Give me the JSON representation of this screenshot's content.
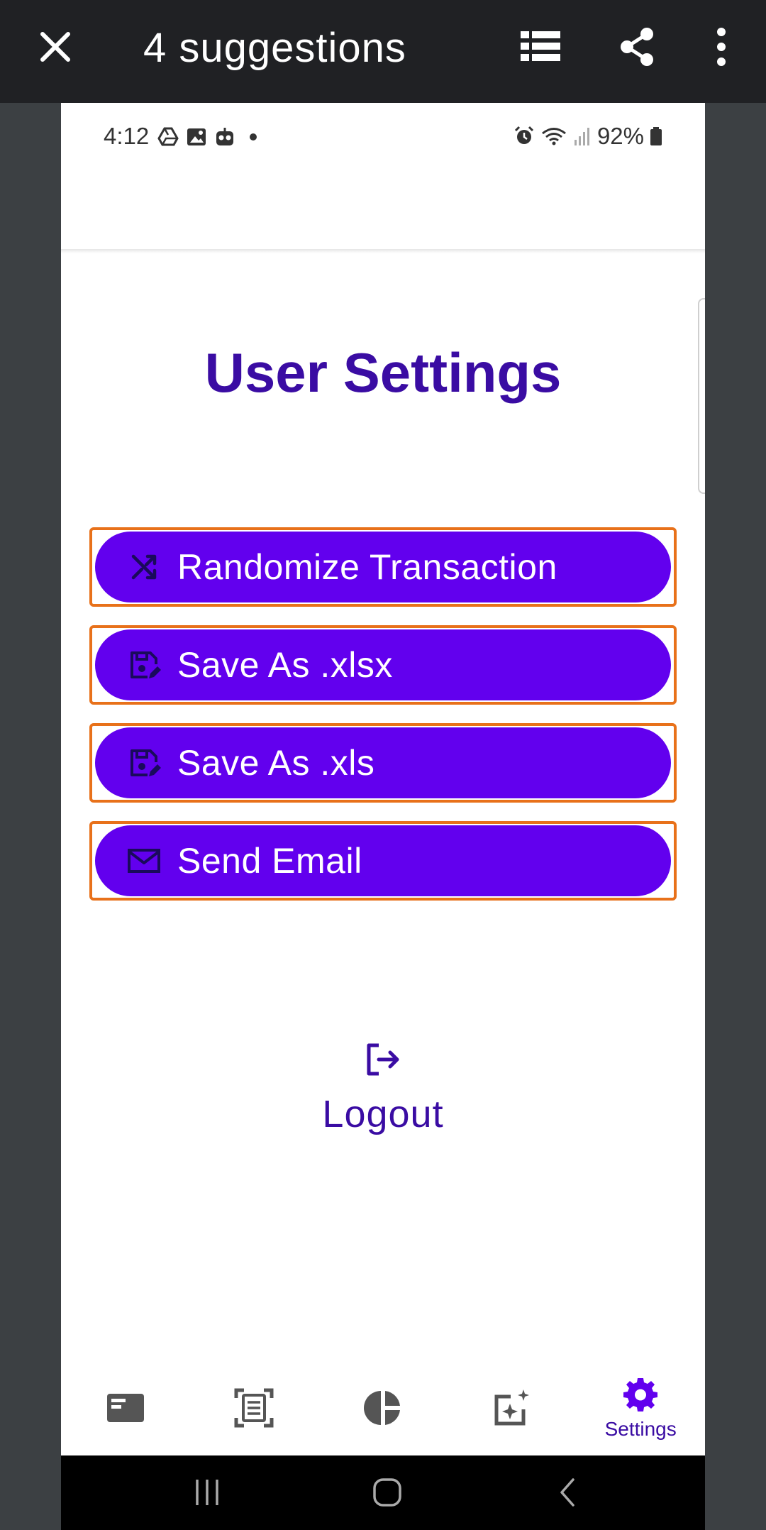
{
  "viewer": {
    "title": "4 suggestions",
    "icons": {
      "close": "close-icon",
      "list": "list-view-icon",
      "share": "share-icon",
      "more": "more-vert-icon"
    }
  },
  "status_bar": {
    "time": "4:12",
    "battery": "92%",
    "icons": [
      "drive-icon",
      "gallery-icon",
      "robot-icon",
      "dot",
      "alarm-icon",
      "wifi-icon",
      "signal-icon",
      "battery-icon"
    ]
  },
  "page": {
    "title": "User Settings"
  },
  "actions": [
    {
      "label": "Randomize Transaction",
      "icon": "shuffle-icon"
    },
    {
      "label": "Save As .xlsx",
      "icon": "save-edit-icon"
    },
    {
      "label": "Save As .xls",
      "icon": "save-edit-icon"
    },
    {
      "label": "Send Email",
      "icon": "mail-icon"
    }
  ],
  "logout": {
    "label": "Logout",
    "icon": "logout-icon"
  },
  "bottom_nav": {
    "items": [
      {
        "icon": "card-icon"
      },
      {
        "icon": "document-scan-icon"
      },
      {
        "icon": "pie-chart-icon"
      },
      {
        "icon": "sparkle-edit-icon"
      },
      {
        "icon": "gear-icon",
        "label": "Settings",
        "active": true
      }
    ]
  },
  "colors": {
    "primary": "#6200ee",
    "title": "#3a0ca3",
    "highlight_border": "#e8711a",
    "toolbar_bg": "#202124",
    "backdrop": "#3c4043"
  }
}
